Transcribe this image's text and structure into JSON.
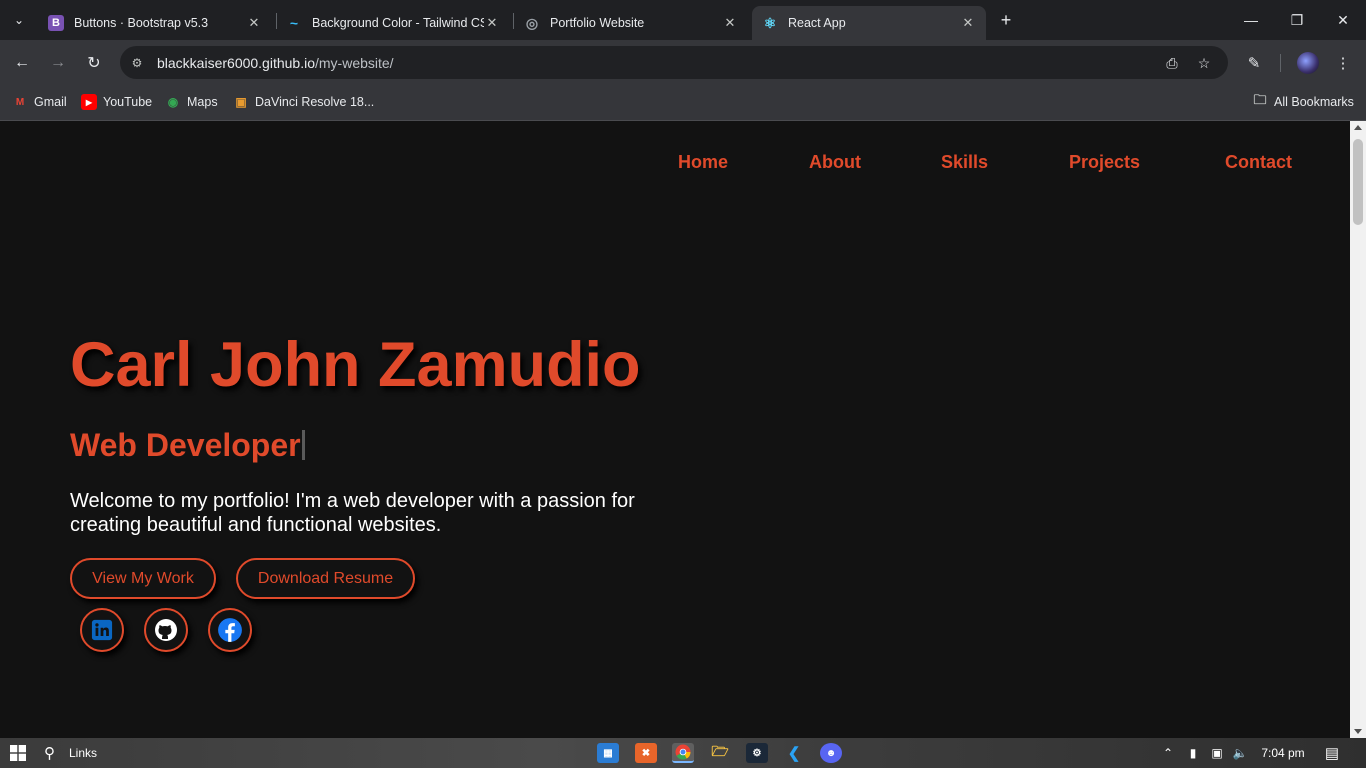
{
  "browser": {
    "tabs": [
      {
        "title": "Buttons · Bootstrap v5.3",
        "favicon": "B",
        "favicon_color": "#7952b3"
      },
      {
        "title": "Background Color - Tailwind CSS",
        "favicon": "~",
        "favicon_color": "#38bdf8"
      },
      {
        "title": "Portfolio Website",
        "favicon": "◎",
        "favicon_color": "#9aa0a6"
      },
      {
        "title": "React App",
        "favicon": "⚛",
        "favicon_color": "#61dafb"
      }
    ],
    "active_tab": 3,
    "new_tab_label": "+",
    "url_host": "blackkaiser6000.github.io",
    "url_path": "/my-website/",
    "bookmarks": [
      {
        "label": "Gmail",
        "icon": "M",
        "color": "#ea4335"
      },
      {
        "label": "YouTube",
        "icon": "▶",
        "color": "#ff0000"
      },
      {
        "label": "Maps",
        "icon": "◉",
        "color": "#34a853"
      },
      {
        "label": "DaVinci Resolve 18...",
        "icon": "▣",
        "color": "#e89b2f"
      }
    ],
    "all_bookmarks": "All Bookmarks"
  },
  "site": {
    "nav": [
      "Home",
      "About",
      "Skills",
      "Projects",
      "Contact"
    ],
    "name": "Carl John Zamudio",
    "role": "Web Developer",
    "intro": "Welcome to my portfolio! I'm a web developer with a passion for creating beautiful and functional websites.",
    "buttons": {
      "work": "View My Work",
      "resume": "Download Resume"
    },
    "social": [
      "linkedin-icon",
      "github-icon",
      "facebook-icon"
    ],
    "accent": "#e04a2b"
  },
  "taskbar": {
    "search_label": "Links",
    "time": "7:04 pm"
  }
}
